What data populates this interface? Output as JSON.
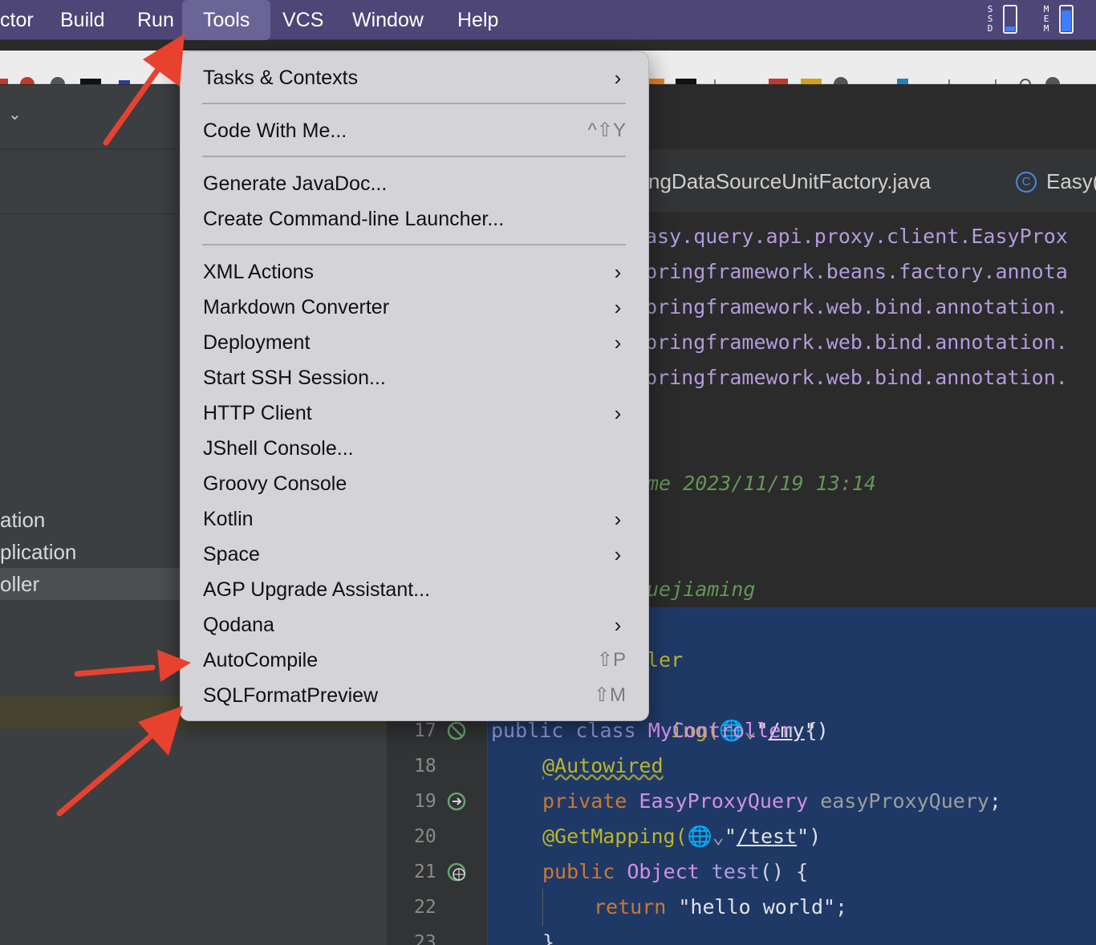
{
  "menubar": {
    "items": [
      {
        "label": "ctor",
        "selected": false
      },
      {
        "label": "Build",
        "selected": false
      },
      {
        "label": "Run",
        "selected": false
      },
      {
        "label": "Tools",
        "selected": true
      },
      {
        "label": "VCS",
        "selected": false
      },
      {
        "label": "Window",
        "selected": false
      },
      {
        "label": "Help",
        "selected": false
      }
    ],
    "status": {
      "ssd_letters": [
        "S",
        "S",
        "D"
      ],
      "mem_letters": [
        "M",
        "E",
        "M"
      ]
    }
  },
  "tools_menu": {
    "items": [
      {
        "label": "Tasks & Contexts",
        "submenu": true,
        "shortcut": ""
      },
      {
        "label": "Code With Me...",
        "submenu": false,
        "shortcut": "^⇧Y"
      },
      {
        "label": "Generate JavaDoc...",
        "submenu": false,
        "shortcut": ""
      },
      {
        "label": "Create Command-line Launcher...",
        "submenu": false,
        "shortcut": ""
      },
      {
        "label": "XML Actions",
        "submenu": true,
        "shortcut": ""
      },
      {
        "label": "Markdown Converter",
        "submenu": true,
        "shortcut": ""
      },
      {
        "label": "Deployment",
        "submenu": true,
        "shortcut": ""
      },
      {
        "label": "Start SSH Session...",
        "submenu": false,
        "shortcut": ""
      },
      {
        "label": "HTTP Client",
        "submenu": true,
        "shortcut": ""
      },
      {
        "label": "JShell Console...",
        "submenu": false,
        "shortcut": ""
      },
      {
        "label": "Groovy Console",
        "submenu": false,
        "shortcut": ""
      },
      {
        "label": "Kotlin",
        "submenu": true,
        "shortcut": ""
      },
      {
        "label": "Space",
        "submenu": true,
        "shortcut": ""
      },
      {
        "label": "AGP Upgrade Assistant...",
        "submenu": false,
        "shortcut": ""
      },
      {
        "label": "Qodana",
        "submenu": true,
        "shortcut": ""
      },
      {
        "label": "AutoCompile",
        "submenu": false,
        "shortcut": "⇧P"
      },
      {
        "label": "SQLFormatPreview",
        "submenu": false,
        "shortcut": "⇧M"
      }
    ]
  },
  "project_tree": {
    "items": [
      "ation",
      "plication",
      "oller"
    ]
  },
  "editor": {
    "tabs": [
      "ngDataSourceUnitFactory.java",
      "Easy("
    ],
    "tab_icon": "C",
    "imports": [
      "asy.query.api.proxy.client.EasyProx",
      "pringframework.beans.factory.annota",
      "pringframework.web.bind.annotation.",
      "pringframework.web.bind.annotation.",
      "pringframework.web.bind.annotation."
    ],
    "comment_time": "me 2023/11/19 13:14",
    "comment_author": "uejiaming",
    "line_ler": "ler",
    "line_mapping_fragment": "ing(",
    "line_mapping_path": "/my",
    "line_numbers": [
      "17",
      "18",
      "19",
      "20",
      "21",
      "22",
      "23"
    ],
    "code": {
      "l17_public": "public",
      "l17_class": "class",
      "l17_name": "MyController",
      "l17_brace": "{",
      "l18_annotation": "@Autowired",
      "l19_private": "private",
      "l19_type": "EasyProxyQuery",
      "l19_field": "easyProxyQuery",
      "l19_semi": ";",
      "l20_annotation": "@GetMapping(",
      "l20_path": "/test",
      "l21_public": "public",
      "l21_type": "Object",
      "l21_method": "test",
      "l21_rest": "() {",
      "l22_return": "return",
      "l22_string": "\"hello world\"",
      "l22_semi": ";",
      "l23_brace": "}"
    }
  },
  "colors": {
    "menubar": "#4d4677",
    "menu_bg": "#d4d4d8",
    "annotation_arrow": "#e8422f",
    "selection": "#1f3966"
  }
}
